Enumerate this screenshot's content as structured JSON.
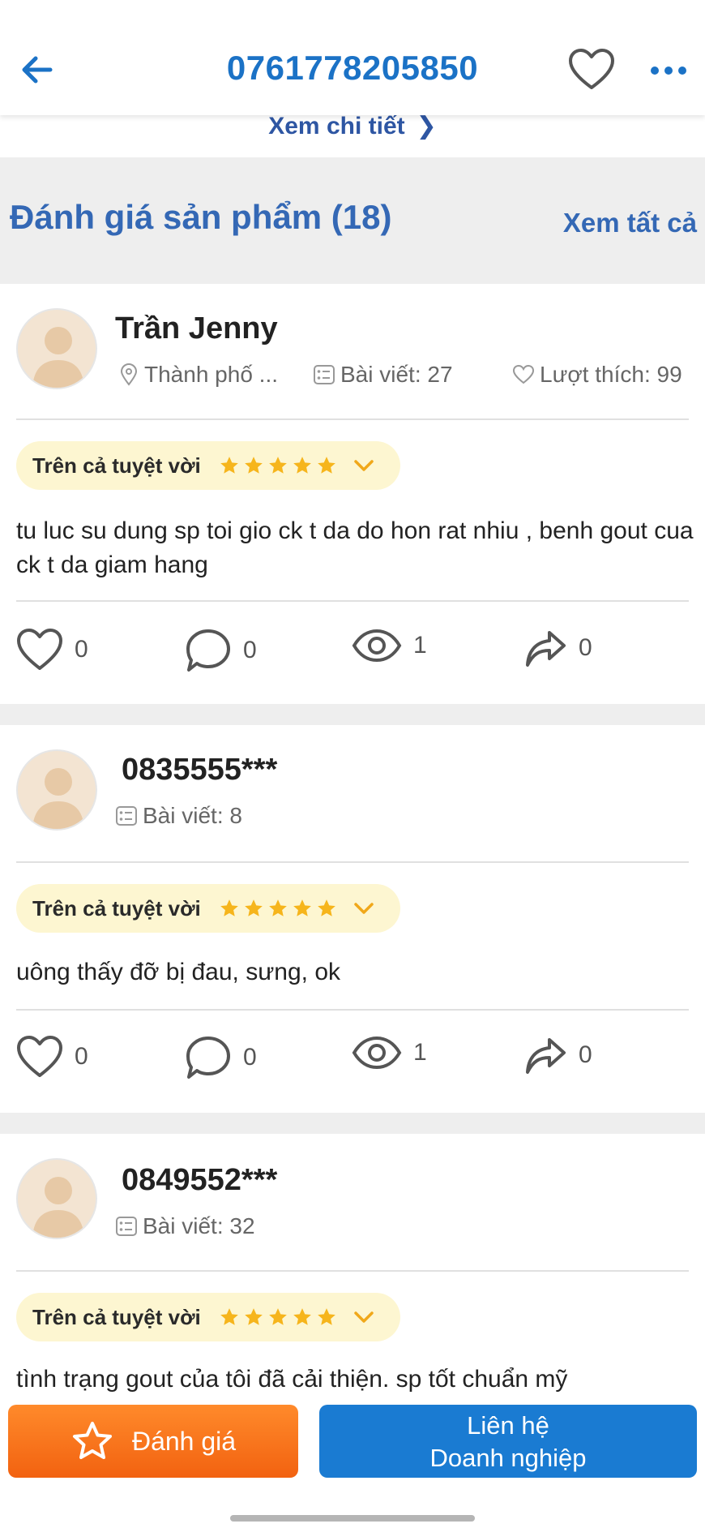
{
  "header": {
    "title": "0761778205850",
    "icons": {
      "back": "back-arrow-icon",
      "favorite": "heart-outline-icon",
      "more": "more-dots-icon"
    }
  },
  "detail_link": {
    "label": "Xem chi tiết"
  },
  "reviews_section": {
    "title": "Đánh giá sản phẩm (18)",
    "see_all": "Xem tất cả"
  },
  "reviews": [
    {
      "name": "Trần Jenny",
      "location": "Thành phố ...",
      "posts": "Bài viết: 27",
      "likes_total": "Lượt thích: 99",
      "rating_label": "Trên cả tuyệt vời",
      "stars": 5,
      "comment": "tu luc su dung sp toi gio ck t da do hon rat nhiu , benh gout cua ck t da giam hang",
      "stats": {
        "likes": "0",
        "comments": "0",
        "views": "1",
        "shares": "0"
      }
    },
    {
      "name": "0835555***",
      "posts": "Bài viết: 8",
      "rating_label": "Trên cả tuyệt vời",
      "stars": 5,
      "comment": "uông thấy đỡ bị đau, sưng, ok",
      "stats": {
        "likes": "0",
        "comments": "0",
        "views": "1",
        "shares": "0"
      }
    },
    {
      "name": "0849552***",
      "posts": "Bài viết: 32",
      "rating_label": "Trên cả tuyệt vời",
      "stars": 5,
      "comment": "tình trạng gout của tôi đã cải thiện. sp tốt chuẩn mỹ"
    }
  ],
  "bottom_bar": {
    "rate_label": "Đánh giá",
    "contact_line1": "Liên hệ",
    "contact_line2": "Doanh nghiệp"
  },
  "colors": {
    "primary_blue": "#1b72c6",
    "section_blue": "#3468b5",
    "star_yellow": "#f6b51c",
    "pill_bg": "#fdf6d1",
    "orange": "#f26210",
    "contact_blue": "#1a7bd2"
  }
}
